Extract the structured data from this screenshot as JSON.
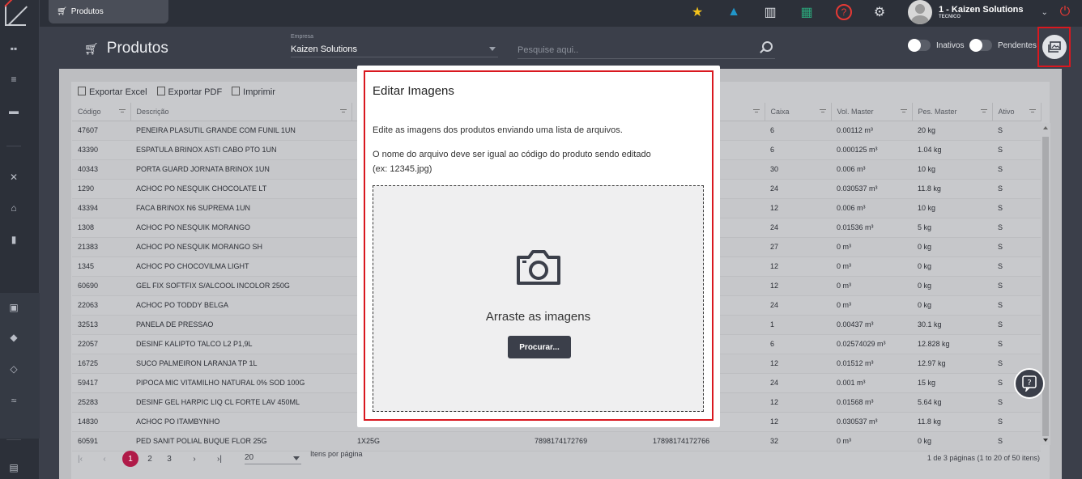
{
  "app": {
    "brand_colors": {
      "accent": "#b01a48",
      "highlight": "#d9181f",
      "dark": "#2c3039"
    }
  },
  "topbar": {
    "tab_label": "Produtos",
    "user_name": "1 - Kaizen Solutions",
    "user_role": "TECNICO",
    "icons": [
      "star-icon",
      "graduation-icon",
      "map-icon",
      "chart-icon",
      "help-icon",
      "gear-icon",
      "logout-icon"
    ]
  },
  "header": {
    "title": "Produtos",
    "empresa_label": "Empresa",
    "empresa_value": "Kaizen Solutions",
    "search_placeholder": "Pesquise aqui..",
    "toggle_inativos": "Inativos",
    "toggle_pendentes": "Pendentes"
  },
  "toolbar": {
    "export_excel": "Exportar Excel",
    "export_pdf": "Exportar PDF",
    "print": "Imprimir"
  },
  "table": {
    "columns": {
      "codigo": "Código",
      "descricao": "Descrição",
      "caixa": "Caixa",
      "vol_master": "Vol. Master",
      "pes_master": "Pes. Master",
      "ativo": "Ativo"
    },
    "rows": [
      [
        "47607",
        "PENEIRA PLASUTIL GRANDE COM FUNIL 1UN",
        "",
        "",
        "",
        "6",
        "0.00112 m³",
        "20 kg",
        "S"
      ],
      [
        "43390",
        "ESPATULA BRINOX ASTI CABO PTO 1UN",
        "",
        "",
        "",
        "6",
        "0.000125 m³",
        "1.04 kg",
        "S"
      ],
      [
        "40343",
        "PORTA GUARD JORNATA BRINOX 1UN",
        "",
        "",
        "",
        "30",
        "0.006 m³",
        "10 kg",
        "S"
      ],
      [
        "1290",
        "ACHOC PO NESQUIK CHOCOLATE LT",
        "",
        "",
        "",
        "24",
        "0.030537 m³",
        "11.8 kg",
        "S"
      ],
      [
        "43394",
        "FACA BRINOX N6 SUPREMA 1UN",
        "",
        "",
        "",
        "12",
        "0.006 m³",
        "10 kg",
        "S"
      ],
      [
        "1308",
        "ACHOC PO NESQUIK MORANGO",
        "",
        "",
        "",
        "24",
        "0.01536 m³",
        "5 kg",
        "S"
      ],
      [
        "21383",
        "ACHOC PO NESQUIK MORANGO SH",
        "",
        "",
        "",
        "27",
        "0 m³",
        "0 kg",
        "S"
      ],
      [
        "1345",
        "ACHOC PO CHOCOVILMA LIGHT",
        "",
        "",
        "",
        "12",
        "0 m³",
        "0 kg",
        "S"
      ],
      [
        "60690",
        "GEL FIX SOFTFIX S/ALCOOL INCOLOR 250G",
        "",
        "",
        "",
        "12",
        "0 m³",
        "0 kg",
        "S"
      ],
      [
        "22063",
        "ACHOC PO TODDY BELGA",
        "",
        "",
        "",
        "24",
        "0 m³",
        "0 kg",
        "S"
      ],
      [
        "32513",
        "PANELA DE PRESSAO",
        "",
        "",
        "",
        "1",
        "0.00437 m³",
        "30.1 kg",
        "S"
      ],
      [
        "22057",
        "DESINF KALIPTO TALCO L2 P1,9L",
        "",
        "",
        "",
        "6",
        "0.02574029 m³",
        "12.828 kg",
        "S"
      ],
      [
        "16725",
        "SUCO PALMEIRON LARANJA TP 1L",
        "",
        "",
        "",
        "12",
        "0.01512 m³",
        "12.97 kg",
        "S"
      ],
      [
        "59417",
        "PIPOCA MIC VITAMILHO NATURAL 0% SOD 100G",
        "",
        "",
        "",
        "24",
        "0.001 m³",
        "15 kg",
        "S"
      ],
      [
        "25283",
        "DESINF GEL HARPIC LIQ CL FORTE LAV 450ML",
        "",
        "",
        "",
        "12",
        "0.01568 m³",
        "5.64 kg",
        "S"
      ],
      [
        "14830",
        "ACHOC PO ITAMBYNHO",
        "",
        "",
        "",
        "12",
        "0.030537 m³",
        "11.8 kg",
        "S"
      ],
      [
        "60591",
        "PED SANIT POLIAL BUQUE FLOR 25G",
        "1X25G",
        "7898174172769",
        "17898174172766",
        "32",
        "0 m³",
        "0 kg",
        "S"
      ]
    ]
  },
  "pager": {
    "pages": [
      "1",
      "2",
      "3"
    ],
    "per_page": "20",
    "per_page_label": "Itens por página",
    "summary": "1 de 3 páginas (1 to 20 of 50 itens)"
  },
  "modal": {
    "title": "Editar Imagens",
    "line1": "Edite as imagens dos produtos enviando uma lista de arquivos.",
    "line2": "O nome do arquivo deve ser igual ao código do produto sendo editado",
    "line3": "(ex: 12345.jpg)",
    "drop_text": "Arraste as imagens",
    "browse_label": "Procurar..."
  }
}
